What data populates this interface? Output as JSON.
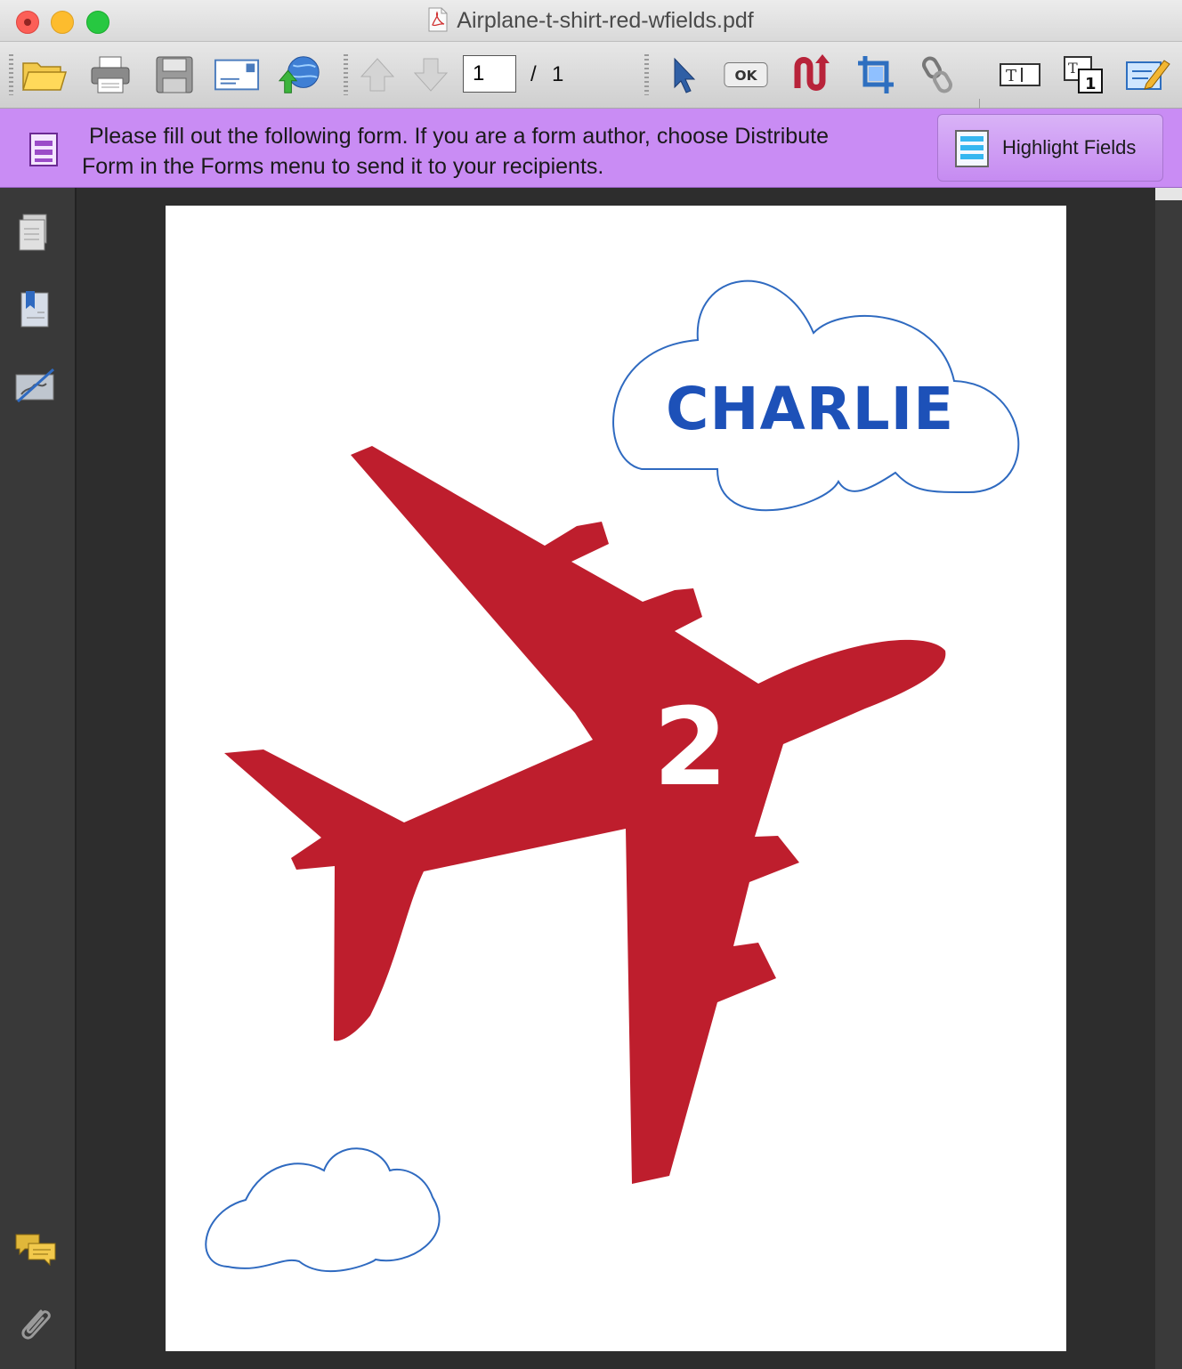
{
  "window": {
    "title": "Airplane-t-shirt-red-wfields.pdf"
  },
  "toolbar": {
    "tools": [
      {
        "name": "open-icon"
      },
      {
        "name": "print-icon"
      },
      {
        "name": "save-icon"
      },
      {
        "name": "email-icon"
      },
      {
        "name": "upload-web-icon"
      },
      {
        "name": "previous-page-icon"
      },
      {
        "name": "next-page-icon"
      },
      {
        "name": "select-arrow-icon"
      },
      {
        "name": "ok-button-icon"
      },
      {
        "name": "loop-icon"
      },
      {
        "name": "crop-icon"
      },
      {
        "name": "link-icon"
      },
      {
        "name": "text-field-icon"
      },
      {
        "name": "text-number-icon"
      },
      {
        "name": "edit-form-icon"
      }
    ],
    "current_page": "1",
    "page_separator": "/",
    "total_pages": "1"
  },
  "form_bar": {
    "message_line1": "Please fill out the following form. If you are a form author, choose Distribute",
    "message_line2": "Form in the Forms menu to send it to your recipients.",
    "highlight_button_label": "Highlight Fields",
    "background_color": "#c98cf4"
  },
  "sidebar": {
    "items": [
      {
        "name": "pages-icon"
      },
      {
        "name": "bookmarks-icon"
      },
      {
        "name": "signatures-icon"
      },
      {
        "name": "comments-icon"
      },
      {
        "name": "attachments-icon"
      }
    ]
  },
  "document": {
    "name_field": "CHARLIE",
    "number_field": "2",
    "airplane_color": "#be1e2d",
    "cloud_stroke_color": "#2f6ac0",
    "name_color": "#1d51b8"
  }
}
